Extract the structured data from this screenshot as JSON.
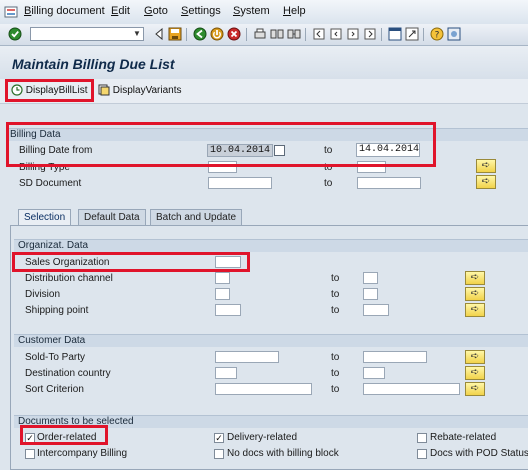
{
  "menu": {
    "items": [
      {
        "underline": "B",
        "rest": "illing document"
      },
      {
        "underline": "E",
        "rest": "dit"
      },
      {
        "underline": "G",
        "rest": "oto"
      },
      {
        "underline": "S",
        "rest": "ettings"
      },
      {
        "underline": "S",
        "rest": "ystem"
      },
      {
        "underline": "H",
        "rest": "elp"
      }
    ]
  },
  "command_field": {
    "value": ""
  },
  "title": "Maintain Billing Due List",
  "app_toolbar": {
    "display_bill_list": "DisplayBillList",
    "display_variants": "DisplayVariants"
  },
  "billing_data": {
    "header": "Billing Data",
    "to_label": "to",
    "rows": [
      {
        "label": "Billing Date from",
        "from": "10.04.2014",
        "to": "14.04.2014"
      },
      {
        "label": "Billing Type",
        "from": "",
        "to": ""
      },
      {
        "label": "SD Document",
        "from": "",
        "to": ""
      }
    ]
  },
  "tabs": [
    {
      "label": "Selection",
      "active": true
    },
    {
      "label": "Default Data",
      "active": false
    },
    {
      "label": "Batch and Update",
      "active": false
    }
  ],
  "organizational_data": {
    "header": "Organizat. Data",
    "to_label": "to",
    "rows": [
      {
        "label": "Sales Organization",
        "from": ""
      },
      {
        "label": "Distribution channel",
        "from": "",
        "to": ""
      },
      {
        "label": "Division",
        "from": "",
        "to": ""
      },
      {
        "label": "Shipping point",
        "from": "",
        "to": ""
      }
    ]
  },
  "customer_data": {
    "header": "Customer Data",
    "to_label": "to",
    "rows": [
      {
        "label": "Sold-To Party",
        "from": "",
        "to": ""
      },
      {
        "label": "Destination country",
        "from": "",
        "to": ""
      },
      {
        "label": "Sort Criterion",
        "from": "",
        "to": ""
      }
    ]
  },
  "documents": {
    "header": "Documents to be selected",
    "checkboxes": [
      {
        "label": "Order-related",
        "checked": true
      },
      {
        "label": "Delivery-related",
        "checked": true
      },
      {
        "label": "Rebate-related",
        "checked": false
      },
      {
        "label": "Intercompany Billing",
        "checked": false
      },
      {
        "label": "No docs with billing block",
        "checked": false
      },
      {
        "label": "Docs with POD Status",
        "checked": false
      }
    ]
  },
  "colors": {
    "highlight_box": "#e0142b",
    "multiple_selection_button": "#f1d24a"
  },
  "icons": {
    "multiple_selection": "multiple-selection-arrow-icon",
    "enter": "enter-checkmark-icon",
    "save": "save-icon",
    "calendar": "calendar-icon"
  }
}
